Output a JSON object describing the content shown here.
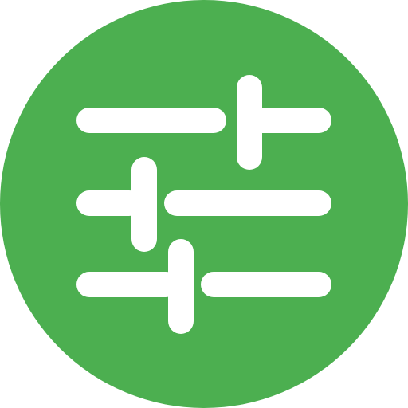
{
  "icon": {
    "name": "sliders-settings-icon",
    "background_color": "#4CAF50",
    "foreground_color": "#FFFFFF"
  },
  "sliders": [
    {
      "name": "slider-1",
      "level": 0.63
    },
    {
      "name": "slider-2",
      "level": 0.27
    },
    {
      "name": "slider-3",
      "level": 0.42
    }
  ]
}
